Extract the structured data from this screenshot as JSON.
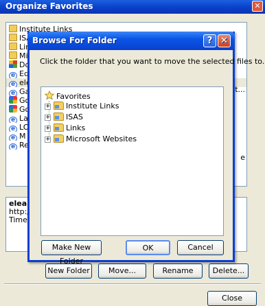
{
  "organize_window": {
    "title": "Organize Favorites",
    "close_glyph": "✕",
    "items": [
      {
        "label": "Institute Links",
        "icon": "folder"
      },
      {
        "label": "ISAS",
        "icon": "folder"
      },
      {
        "label": "Links",
        "icon": "folder"
      },
      {
        "label": "Microsoft Websites",
        "icon": "folder"
      },
      {
        "label": "Do",
        "icon": "multicolor"
      },
      {
        "label": "Ed",
        "icon": "ie"
      },
      {
        "label": "ele",
        "icon": "ie"
      },
      {
        "label": "Ga",
        "icon": "ie"
      },
      {
        "label": "Go",
        "icon": "google"
      },
      {
        "label": "Go",
        "icon": "google"
      },
      {
        "label": "La",
        "icon": "ie"
      },
      {
        "label": "LO",
        "icon": "ie"
      },
      {
        "label": "M",
        "icon": "ie"
      },
      {
        "label": "Re",
        "icon": "ie"
      }
    ],
    "right_fragments": [
      "it...",
      "e"
    ],
    "info": {
      "name": "elear",
      "url": "http://",
      "visits": "Times v"
    },
    "buttons": {
      "new_folder": "New Folder",
      "move": "Move...",
      "rename": "Rename",
      "delete": "Delete...",
      "close": "Close"
    }
  },
  "browse_dialog": {
    "title": "Browse For Folder",
    "help_glyph": "?",
    "close_glyph": "✕",
    "instruction": "Click the folder that you want to move the selected files to.",
    "tree": {
      "root": "Favorites",
      "expander_glyph": "+",
      "folders": [
        "Institute Links",
        "ISAS",
        "Links",
        "Microsoft Websites"
      ]
    },
    "buttons": {
      "make_new_folder": "Make New Folder",
      "ok": "OK",
      "cancel": "Cancel"
    }
  },
  "colors": {
    "titlebar_blue": "#0a46d3",
    "dialog_face": "#ece9d8",
    "close_red": "#cf3f1c"
  }
}
